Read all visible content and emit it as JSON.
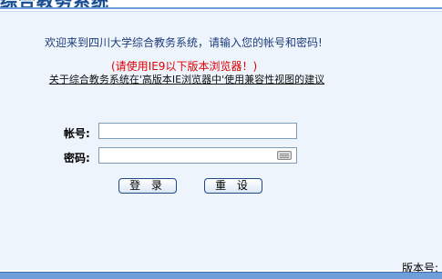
{
  "header": {
    "banner_title": "综合教务系统"
  },
  "login": {
    "welcome": "欢迎来到四川大学综合教务系统，请输入您的帐号和密码!",
    "ie_warning": "(请使用IE9以下版本浏览器！)",
    "compat_link": "关于综合教务系统在'高版本IE浏览器中'使用兼容性视图的建议",
    "account_label": "帐号:",
    "password_label": "密码:",
    "account_value": "",
    "password_value": "",
    "login_button": "登 录",
    "reset_button": "重 设"
  },
  "footer": {
    "version_label": "版本号:"
  },
  "colors": {
    "banner_text": "#1b4c8f",
    "panel_bg": "#eef4fc",
    "warning": "#e00000",
    "button_border": "#204a86",
    "bottom_bar": "#6e9fd8"
  },
  "icons": [
    "keyboard-icon"
  ]
}
